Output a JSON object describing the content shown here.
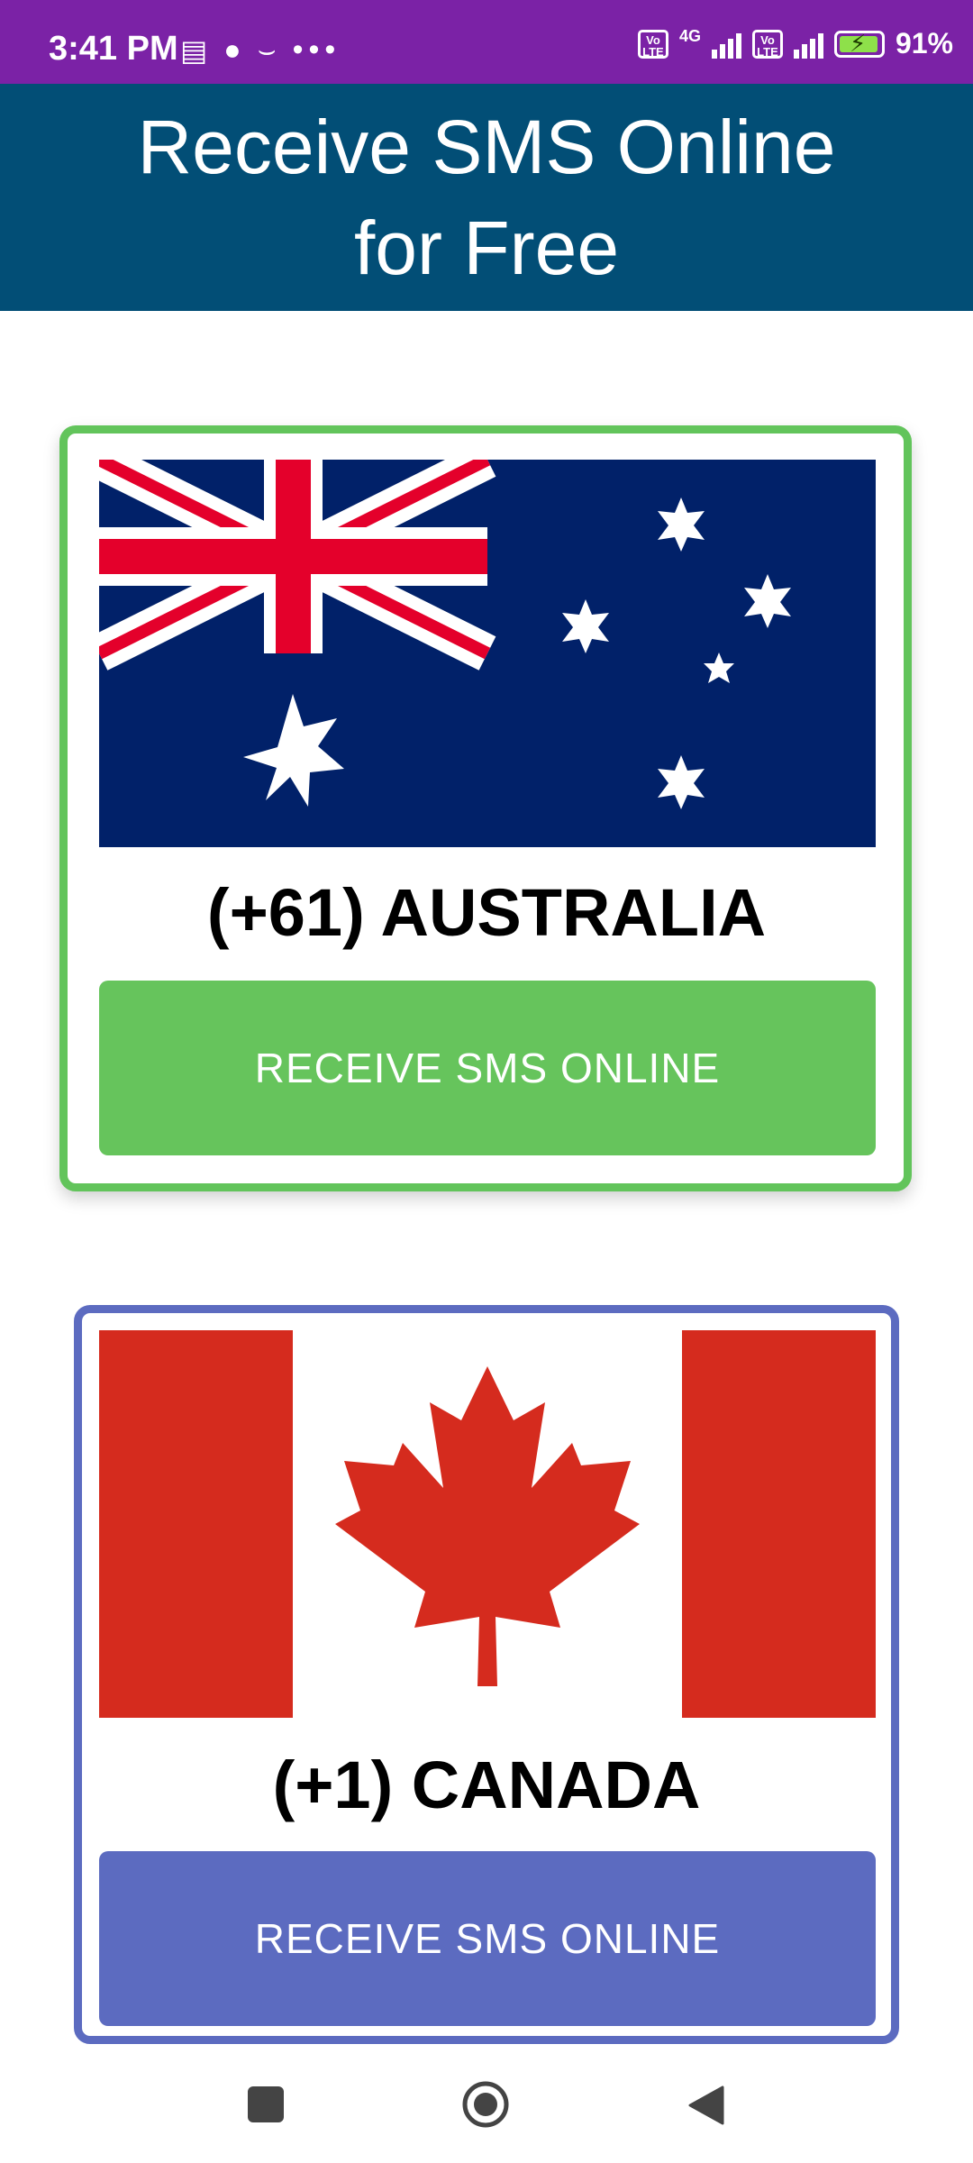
{
  "status_bar": {
    "time": "3:41 PM",
    "left_icons": [
      "message-icon",
      "robot-icon",
      "amazon-icon"
    ],
    "overflow": "•••",
    "network": "4G",
    "volte_label": "Vo LTE",
    "battery_percent": "91%",
    "battery_level": 0.91
  },
  "app_bar": {
    "title": "Receive SMS Online\nfor Free"
  },
  "countries": [
    {
      "name": "(+61) AUSTRALIA",
      "button": "RECEIVE SMS ONLINE",
      "accent": "#62c45b",
      "flag": "australia-flag"
    },
    {
      "name": "(+1) CANADA",
      "button": "RECEIVE SMS ONLINE",
      "accent": "#5c6bc0",
      "flag": "canada-flag"
    }
  ],
  "nav_bar": {
    "icons": [
      "recent-apps-icon",
      "home-icon",
      "back-icon"
    ]
  },
  "colors": {
    "status_bar": "#7b22a6",
    "app_bar": "#024e76",
    "aus_flag_blue": "#012169",
    "aus_flag_red": "#e4002b",
    "canada_red": "#d52b1e"
  }
}
